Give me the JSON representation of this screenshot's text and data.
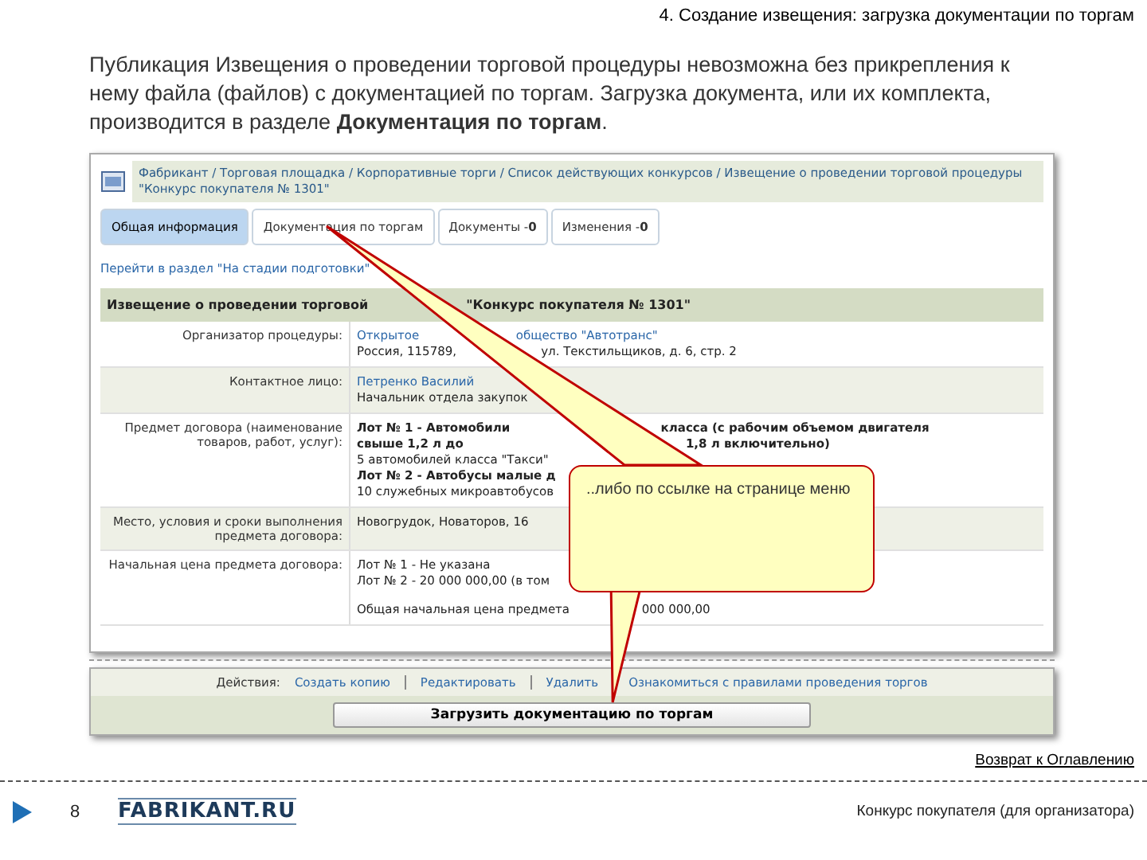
{
  "slide_title": "4. Создание извещения: загрузка документации по торгам",
  "intro": "Публикация Извещения о проведении торговой процедуры невозможна без прикрепления к нему файла (файлов) с документацией по торгам. Загрузка документа, или их комплекта, производится в разделе **Документация по торгам**.",
  "screenshot": {
    "breadcrumb": "Фабрикант / Торговая площадка / Корпоративные торги / Список действующих конкурсов / Извещение о проведении торговой процедуры \"Конкурс покупателя № 1301\"",
    "tabs": [
      {
        "label": "Общая информация",
        "selected": true
      },
      {
        "label": "Документация по торгам",
        "selected": false
      },
      {
        "label": "Документы -",
        "count": "0",
        "selected": false
      },
      {
        "label": "Изменения -",
        "count": "0",
        "selected": false
      }
    ],
    "section_link": "Перейти в раздел \"На стадии подготовки\"",
    "table_title": [
      "Извещение о проведении торговой",
      "\"Конкурс покупателя № 1301\""
    ],
    "rows": [
      {
        "label": "Организатор процедуры:",
        "lines": [
          {
            "kind": "link",
            "parts": [
              "Открытое",
              "общество \"Автотранс\""
            ]
          },
          {
            "kind": "text",
            "parts": [
              "Россия, 115789,",
              "ул. Текстильщиков, д. 6, стр. 2"
            ]
          }
        ]
      },
      {
        "label": "Контактное лицо:",
        "lines": [
          {
            "kind": "link",
            "parts": [
              "Петренко Василий"
            ]
          },
          {
            "kind": "text",
            "parts": [
              "Начальник отдела закупок"
            ]
          }
        ]
      },
      {
        "label": "Предмет договора (наименование товаров, работ, услуг):",
        "lines": [
          {
            "kind": "bold",
            "parts": [
              "Лот № 1 - Автомобили",
              "класса (с рабочим объемом двигателя"
            ]
          },
          {
            "kind": "bold",
            "parts": [
              "свыше 1,2 л до",
              "1,8 л включительно)"
            ]
          },
          {
            "kind": "text",
            "parts": [
              "5 автомобилей класса \"Такси\""
            ]
          },
          {
            "kind": "bold",
            "parts": [
              "Лот № 2 - Автобусы малые д"
            ]
          },
          {
            "kind": "text",
            "parts": [
              "10 служебных микроавтобусов"
            ]
          }
        ]
      },
      {
        "label": "Место, условия и сроки выполнения предмета договора:",
        "lines": [
          {
            "kind": "text",
            "parts": [
              "Новогрудок, Новаторов, 16"
            ]
          }
        ]
      },
      {
        "label": "Начальная цена предмета договора:",
        "lines": [
          {
            "kind": "text",
            "parts": [
              "Лот № 1 - Не указана"
            ]
          },
          {
            "kind": "text",
            "parts": [
              "Лот № 2 - 20 000 000,00 (в том"
            ]
          },
          {
            "kind": "gap",
            "parts": [
              "Общая начальная цена предмета",
              "000 000,00"
            ]
          }
        ]
      }
    ],
    "actions_label": "Действия:",
    "actions": [
      "Создать копию",
      "Редактировать",
      "Удалить",
      "Ознакомиться с правилами проведения торгов"
    ],
    "upload_button": "Загрузить документацию по торгам"
  },
  "callout": "..либо по ссылке на странице меню",
  "toc_link": "Возврат к Оглавлению",
  "footer": {
    "page": "8",
    "logo": "FABRIKANT.RU",
    "caption": "Конкурс покупателя (для организатора)"
  }
}
